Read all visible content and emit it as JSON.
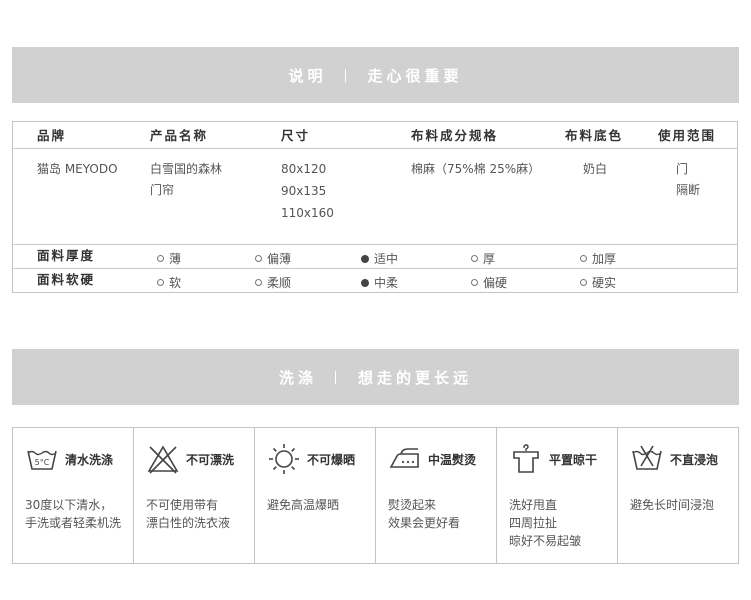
{
  "banner1": {
    "left": "说明",
    "right": "走心很重要"
  },
  "spec": {
    "headers": [
      "品牌",
      "产品名称",
      "尺寸",
      "布料成分规格",
      "布料底色",
      "使用范围"
    ],
    "brand": "猫岛 MEYODO",
    "product": [
      "白雪国的森林",
      "门帘"
    ],
    "sizes": [
      "80x120",
      "90x135",
      "110x160"
    ],
    "fabric": "棉麻（75%棉  25%麻）",
    "color": "奶白",
    "usage": [
      "门",
      "隔断"
    ],
    "thickness": {
      "label": "面料厚度",
      "options": [
        {
          "text": "薄",
          "selected": false
        },
        {
          "text": "偏薄",
          "selected": false
        },
        {
          "text": "适中",
          "selected": true
        },
        {
          "text": "厚",
          "selected": false
        },
        {
          "text": "加厚",
          "selected": false
        }
      ]
    },
    "softness": {
      "label": "面料软硬",
      "options": [
        {
          "text": "软",
          "selected": false
        },
        {
          "text": "柔顺",
          "selected": false
        },
        {
          "text": "中柔",
          "selected": true
        },
        {
          "text": "偏硬",
          "selected": false
        },
        {
          "text": "硬实",
          "selected": false
        }
      ]
    }
  },
  "banner2": {
    "left": "洗涤",
    "right": "想走的更长远"
  },
  "care": [
    {
      "icon": "wash-30-icon",
      "title": "清水洗涤",
      "desc": [
        "30度以下清水，",
        "手洗或者轻柔机洗"
      ]
    },
    {
      "icon": "no-bleach-icon",
      "title": "不可漂洗",
      "desc": [
        "不可使用带有",
        "漂白性的洗衣液"
      ]
    },
    {
      "icon": "no-sun-icon",
      "title": "不可爆晒",
      "desc": [
        "避免高温爆晒"
      ]
    },
    {
      "icon": "iron-icon",
      "title": "中温熨烫",
      "desc": [
        "熨烫起来",
        "效果会更好看"
      ]
    },
    {
      "icon": "hang-dry-icon",
      "title": "平置晾干",
      "desc": [
        "洗好甩直",
        "四周拉扯",
        "晾好不易起皱"
      ]
    },
    {
      "icon": "no-soak-icon",
      "title": "不直浸泡",
      "desc": [
        "避免长时间浸泡"
      ]
    }
  ]
}
